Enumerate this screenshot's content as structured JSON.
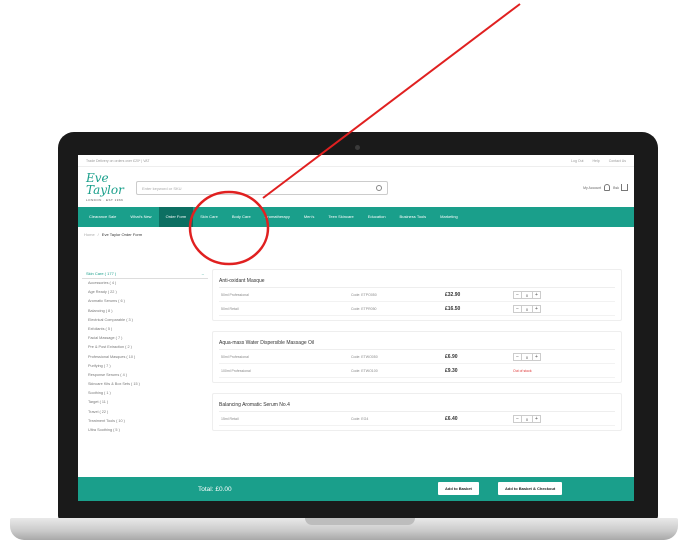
{
  "topbar": {
    "left_text": "Trade Delivery on orders over £20* | VAT",
    "right_links": [
      "Log Out",
      "Help",
      "Contact Us"
    ]
  },
  "brand": {
    "logo_text": "Eve Taylor",
    "logo_sub": "LONDON · EST 1966"
  },
  "search": {
    "placeholder": "Enter keyword or SKU"
  },
  "account": {
    "label": "My Account",
    "basket_label": "Bsk"
  },
  "nav": {
    "items": [
      "Clearance Sale",
      "What's New",
      "Order Form",
      "Skin Care",
      "Body Care",
      "Aromatherapy",
      "Men's",
      "Teen Skincare",
      "Education",
      "Business Tools",
      "Marketing"
    ],
    "active_index": 2
  },
  "breadcrumb": {
    "home": "Home",
    "separator": "/",
    "current": "Eve Taylor Order Form"
  },
  "sidebar": {
    "heading": "Skin Care ( 177 )",
    "collapse_symbol": "–",
    "items": [
      "Accessories ( 4 )",
      "Age Ready ( 22 )",
      "Aromatic Serums ( 6 )",
      "Balancing ( 8 )",
      "Electrical Comparable ( 3 )",
      "Exfoliants ( 5 )",
      "Facial Massage ( 7 )",
      "Pre & Post Extraction ( 2 )",
      "Professional Masques ( 10 )",
      "Purifying ( 7 )",
      "Response Serums ( 4 )",
      "Skincare Kits & Box Sets ( 15 )",
      "Soothing ( 1 )",
      "Target ( 11 )",
      "Travel ( 22 )",
      "Treatment Tools ( 10 )",
      "Ultra Soothing ( 5 )"
    ]
  },
  "products": [
    {
      "title": "Anti-oxidant Masque",
      "rows": [
        {
          "name": "50ml Professional",
          "code": "Code: ETPO050",
          "price": "£32.90",
          "qty": "0",
          "status": ""
        },
        {
          "name": "50ml Retail",
          "code": "Code: ETPR050",
          "price": "£16.50",
          "qty": "0",
          "status": ""
        }
      ]
    },
    {
      "title": "Aqua-mass Water Dispersible Massage Oil",
      "rows": [
        {
          "name": "50ml Professional",
          "code": "Code: ETWO050",
          "price": "£6.90",
          "qty": "0",
          "status": ""
        },
        {
          "name": "100ml Professional",
          "code": "Code: ETWO100",
          "price": "£9.30",
          "qty": "",
          "status": "Out of stock"
        }
      ]
    },
    {
      "title": "Balancing Aromatic Serum No.4",
      "rows": [
        {
          "name": "15ml Retail",
          "code": "Code: EG4",
          "price": "£6.40",
          "qty": "0",
          "status": ""
        }
      ]
    }
  ],
  "footer": {
    "total": "Total: £0.00",
    "add_basket": "Add to Basket",
    "add_checkout": "Add to Basket & Checkout"
  },
  "colors": {
    "brand_teal": "#1a9f8b",
    "annotation_red": "#e02020"
  }
}
